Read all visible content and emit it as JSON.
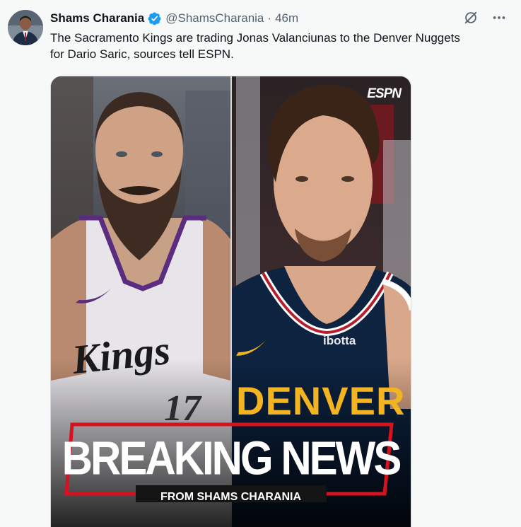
{
  "tweet": {
    "author_name": "Shams Charania",
    "handle": "@ShamsCharania",
    "separator": "·",
    "time": "46m",
    "text": "The Sacramento Kings are trading Jonas Valanciunas to the Denver Nuggets for Dario Saric, sources tell ESPN."
  },
  "icons": {
    "verified": "verified-badge-icon",
    "grok": "grok-icon",
    "more": "more-icon"
  },
  "media": {
    "logo": "ESPN",
    "headline": "BREAKING NEWS",
    "subheadline": "FROM SHAMS CHARANIA",
    "left_jersey_wordmark": "Kings",
    "left_jersey_number": "17",
    "right_jersey_sponsor": "ibotta",
    "right_jersey_wordmark": "DENVER"
  },
  "colors": {
    "verified_blue": "#1d9bf0",
    "breaking_red": "#d6121f",
    "nuggets_navy": "#0d2340",
    "nuggets_gold": "#f2b421",
    "kings_purple": "#5a2d81"
  }
}
